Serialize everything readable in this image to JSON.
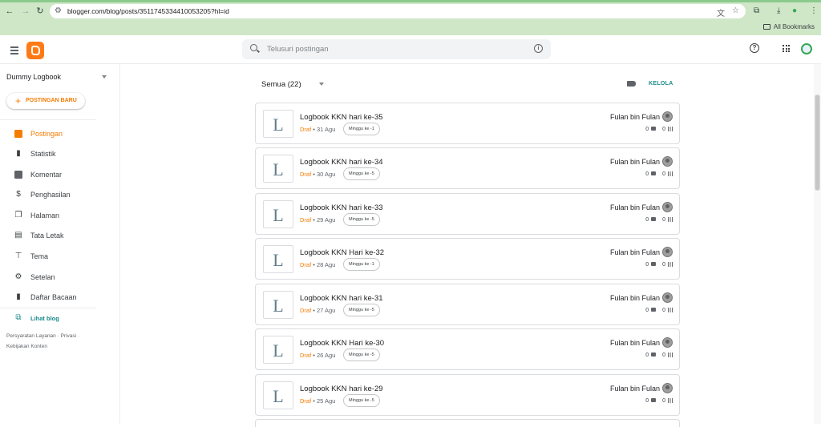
{
  "browser": {
    "url": "blogger.com/blog/posts/3511745334410053205?hl=id",
    "bookmarks_label": "All Bookmarks"
  },
  "search": {
    "placeholder": "Telusuri postingan"
  },
  "sidebar": {
    "blog_name": "Dummy Logbook",
    "new_post_label": "POSTINGAN BARU",
    "items": [
      {
        "label": "Postingan",
        "icon": "posts-icon",
        "active": true
      },
      {
        "label": "Statistik",
        "icon": "stats-icon"
      },
      {
        "label": "Komentar",
        "icon": "comment-icon"
      },
      {
        "label": "Penghasilan",
        "icon": "dollar-icon"
      },
      {
        "label": "Halaman",
        "icon": "pages-icon"
      },
      {
        "label": "Tata Letak",
        "icon": "layout-icon"
      },
      {
        "label": "Tema",
        "icon": "theme-icon"
      },
      {
        "label": "Setelan",
        "icon": "settings-icon"
      },
      {
        "label": "Daftar Bacaan",
        "icon": "bookmark-icon"
      }
    ],
    "view_blog_label": "Lihat blog",
    "footer": {
      "terms": "Persyaratan Layanan",
      "privacy": "Privasi",
      "content_policy": "Kebijakan Konten"
    }
  },
  "toolbar": {
    "filter_label": "Semua (22)",
    "manage_label": "KELOLA"
  },
  "posts": [
    {
      "thumb": "L",
      "title": "Logbook KKN hari ke-35",
      "status": "Draf",
      "date": "31 Agu",
      "label": "Minggu ke -1",
      "author": "Fulan bin Fulan",
      "comments": "0",
      "views": "0"
    },
    {
      "thumb": "L",
      "title": "Logbook KKN hari ke-34",
      "status": "Draf",
      "date": "30 Agu",
      "label": "Minggu ke -5",
      "author": "Fulan bin Fulan",
      "comments": "0",
      "views": "0"
    },
    {
      "thumb": "L",
      "title": "Logbook KKN hari ke-33",
      "status": "Draf",
      "date": "29 Agu",
      "label": "Minggu ke -5",
      "author": "Fulan bin Fulan",
      "comments": "0",
      "views": "0"
    },
    {
      "thumb": "L",
      "title": "Logbook KKN Hari ke-32",
      "status": "Draf",
      "date": "28 Agu",
      "label": "Minggu ke -1",
      "author": "Fulan bin Fulan",
      "comments": "0",
      "views": "0"
    },
    {
      "thumb": "L",
      "title": "Logbook KKN hari ke-31",
      "status": "Draf",
      "date": "27 Agu",
      "label": "Minggu ke -5",
      "author": "Fulan bin Fulan",
      "comments": "0",
      "views": "0"
    },
    {
      "thumb": "L",
      "title": "Logbook KKN Hari ke-30",
      "status": "Draf",
      "date": "26 Agu",
      "label": "Minggu ke -5",
      "author": "Fulan bin Fulan",
      "comments": "0",
      "views": "0"
    },
    {
      "thumb": "L",
      "title": "Logbook KKN hari ke-29",
      "status": "Draf",
      "date": "25 Agu",
      "label": "Minggu ke -5",
      "author": "Fulan bin Fulan",
      "comments": "0",
      "views": "0"
    }
  ],
  "colors": {
    "accent": "#f57c00",
    "teal": "#1a8a8a",
    "chrome_bg": "#cfe7c7"
  }
}
